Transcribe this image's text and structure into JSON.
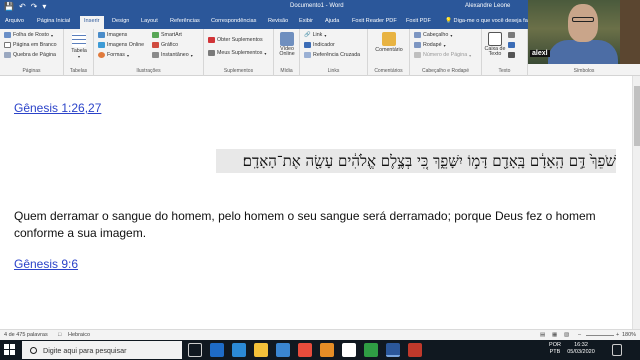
{
  "titlebar": {
    "doc_title": "Documento1 - Word",
    "user_name": "Alexandre Leone"
  },
  "tabs": [
    {
      "label": "Arquivo"
    },
    {
      "label": "Página Inicial"
    },
    {
      "label": "Inserir"
    },
    {
      "label": "Design"
    },
    {
      "label": "Layout"
    },
    {
      "label": "Referências"
    },
    {
      "label": "Correspondências"
    },
    {
      "label": "Revisão"
    },
    {
      "label": "Exibir"
    },
    {
      "label": "Ajuda"
    },
    {
      "label": "Foxit Reader PDF"
    },
    {
      "label": "Foxit PDF"
    },
    {
      "label": "Diga-me o que você deseja fazer"
    }
  ],
  "ribbon": {
    "paginas": {
      "label": "Páginas",
      "items": [
        "Folha de Rosto",
        "Página em Branco",
        "Quebra de Página"
      ]
    },
    "tabelas": {
      "label": "Tabelas",
      "button": "Tabela"
    },
    "ilustracoes": {
      "label": "Ilustrações",
      "items": [
        "Imagens",
        "Imagens Online",
        "Formas",
        "SmartArt",
        "Gráfico",
        "Instantâneo"
      ]
    },
    "suplementos": {
      "label": "Suplementos",
      "items": [
        "Obter Suplementos",
        "Meus Suplementos"
      ]
    },
    "midia": {
      "label": "Mídia",
      "button": "Vídeo Online"
    },
    "links": {
      "label": "Links",
      "items": [
        "Link",
        "Indicador",
        "Referência Cruzada"
      ]
    },
    "comentarios": {
      "label": "Comentários",
      "button": "Comentário"
    },
    "cabecalho": {
      "label": "Cabeçalho e Rodapé",
      "items": [
        "Cabeçalho",
        "Rodapé",
        "Número de Página"
      ]
    },
    "texto": {
      "label": "Texto",
      "button": "Caixa de Texto"
    },
    "simbolos": {
      "label": "Símbolos"
    }
  },
  "webcam": {
    "caption": "alexl"
  },
  "document": {
    "ref1": "Gênesis 1:26,27",
    "hebrew": "שֹׁפֵךְ֙ דַּ֣ם הָֽאָדָ֔ם בָּֽאָדָ֖ם דָּמ֣וֹ יִשָּׁפֵ֑ךְ כִּ֚י בְּצֶ֣לֶם אֱלֹהִ֔ים עָשָׂ֖ה אֶת־הָאָדָֽם׃",
    "verse": "Quem derramar o sangue do homem, pelo homem o seu sangue será derramado; porque Deus fez o homem conforme a sua imagem.",
    "ref2": "Gênesis 9:6"
  },
  "statusbar": {
    "words": "4 de 475 palavras",
    "language": "Hebraico",
    "zoom": "180%"
  },
  "taskbar": {
    "search_placeholder": "Digite aqui para pesquisar",
    "lang_top": "POR",
    "lang_bottom": "PTB",
    "time": "16:32",
    "date": "05/03/2020"
  },
  "colors": {
    "word_blue": "#2b579a",
    "link": "#2b43c9"
  }
}
